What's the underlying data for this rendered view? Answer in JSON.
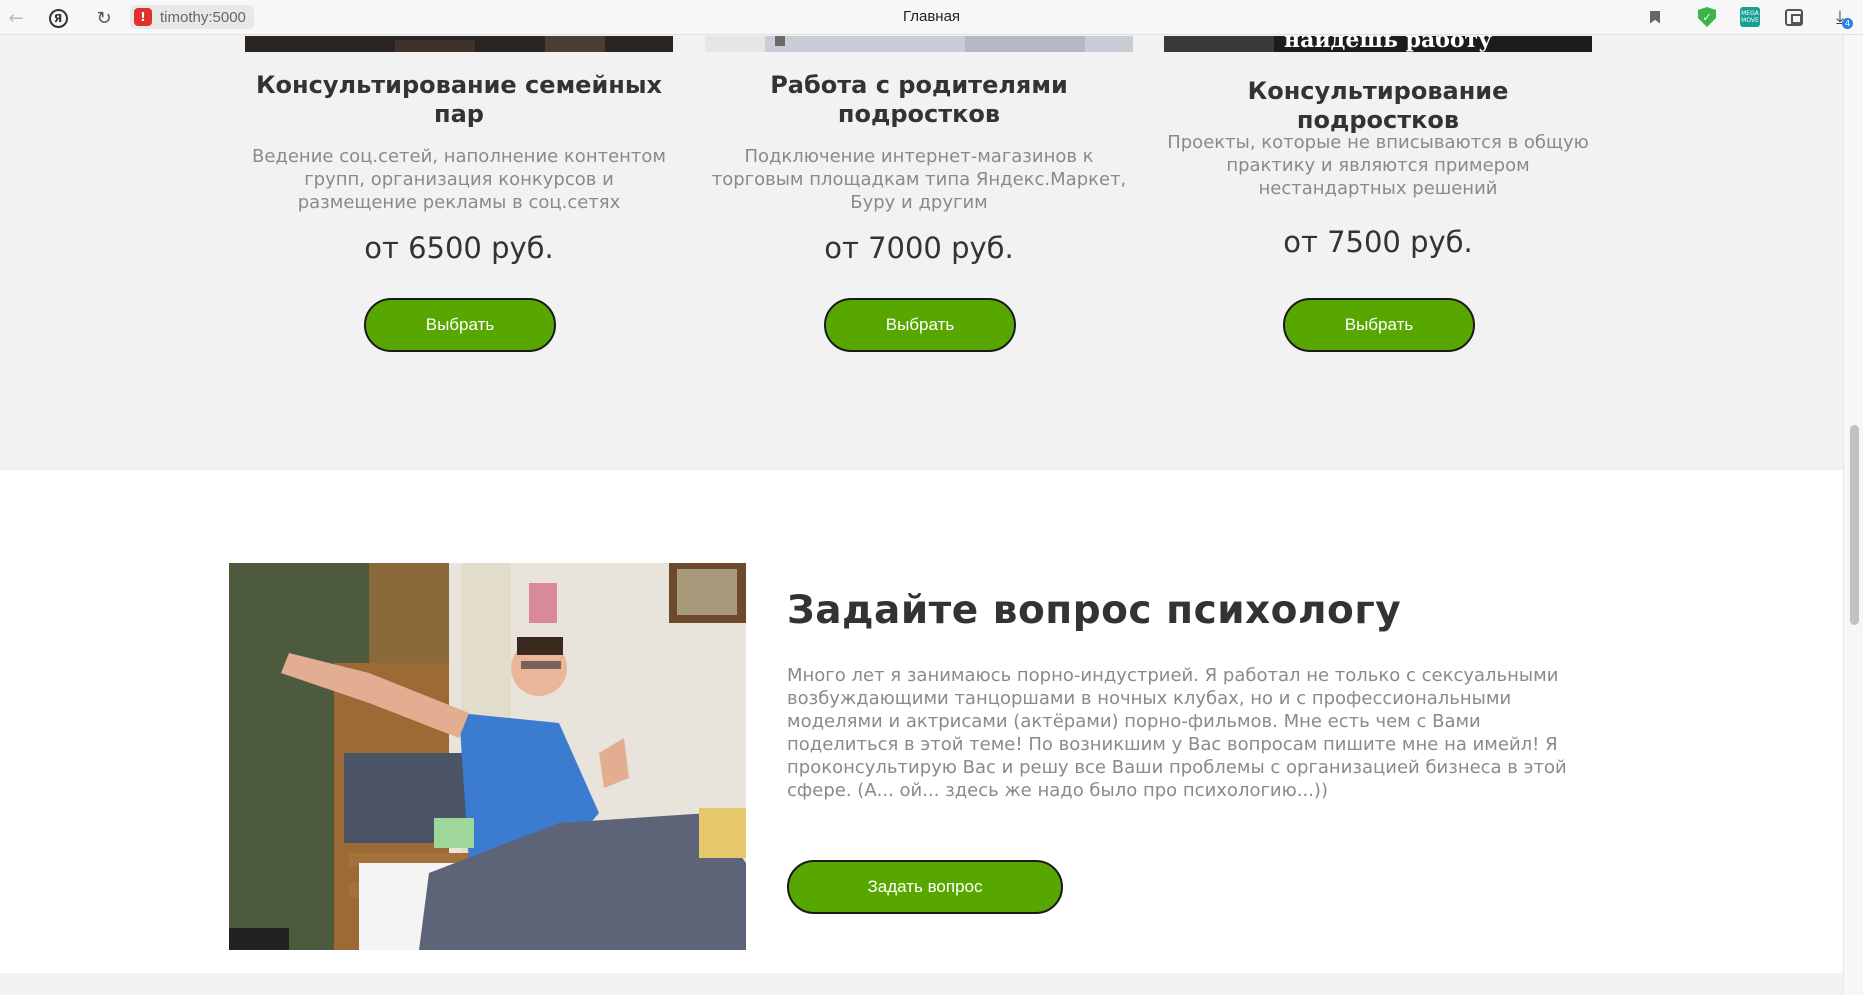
{
  "browser": {
    "url": "timothy:5000",
    "tab_title": "Главная",
    "ext_label": "MEGA\nMOVE",
    "download_count": "4"
  },
  "services": [
    {
      "title": "Консультирование семейных пар",
      "description": "Ведение соц.сетей, наполнение контентом групп, организация конкурсов и размещение рекламы в соц.сетях",
      "price": "от 6500 руб.",
      "button": "Выбрать"
    },
    {
      "title": "Работа с родителями подростков",
      "description": "Подключение интернет-магазинов к торговым площадкам типа Яндекс.Маркет, Буру и другим",
      "price": "от 7000 руб.",
      "button": "Выбрать"
    },
    {
      "title": "Консультирование подростков",
      "description": "Проекты, которые не вписываются в общую практику и являются примером нестандартных решений",
      "price": "от 7500 руб.",
      "button": "Выбрать",
      "image_caption": "найдешь работу"
    }
  ],
  "about": {
    "title": "Задайте вопрос психологу",
    "text": "Много лет я занимаюсь порно-индустрией. Я работал не только с сексуальными возбуждающими танцоршами в ночных клубах, но и с профессиональными моделями и актрисами (актёрами) порно-фильмов. Мне есть чем с Вами поделиться в этой теме! По возникшим у Вас вопросам пишите мне на имейл! Я проконсультирую Вас и решу все Ваши проблемы с организацией бизнеса в этой сфере. (А... ой... здесь же надо было про психологию...))",
    "button": "Задать вопрос"
  },
  "colors": {
    "accent_green": "#58a700",
    "section_gray": "#f2f2f2"
  }
}
